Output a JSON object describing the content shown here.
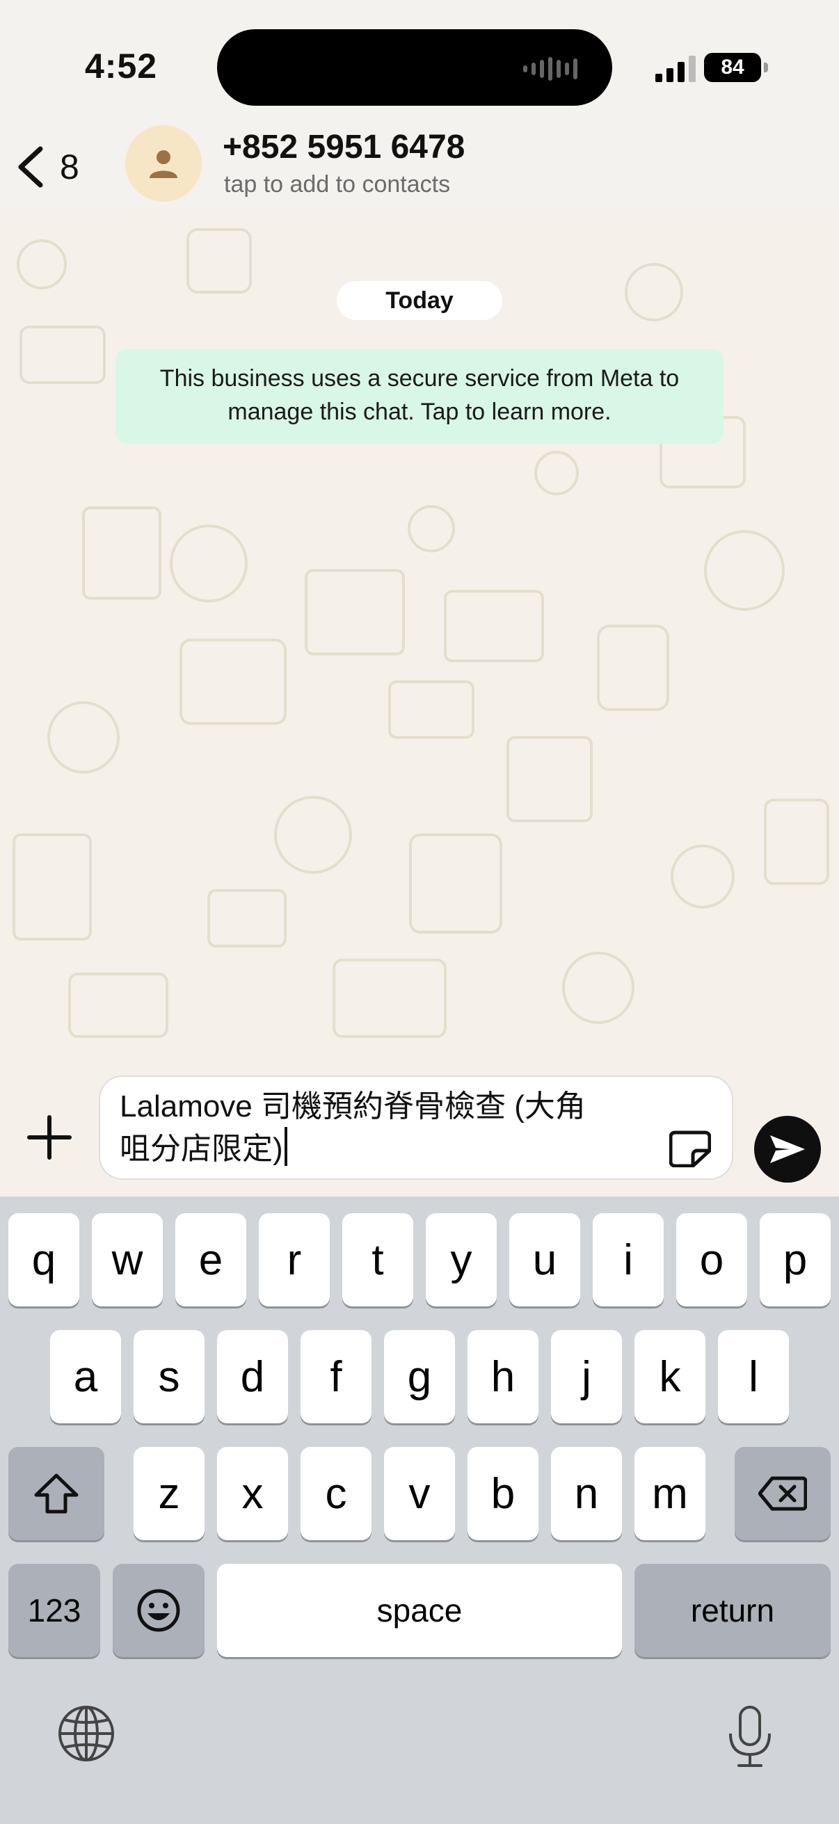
{
  "status_bar": {
    "time": "4:52",
    "battery": "84"
  },
  "header": {
    "back_count": "8",
    "title": "+852 5951 6478",
    "subtitle": "tap to add to contacts"
  },
  "chat": {
    "date_label": "Today",
    "info_message": "This business uses a secure service from Meta to manage this chat. Tap to learn more."
  },
  "composer": {
    "text_line1": "Lalamove 司機預約脊骨檢查 (大角",
    "text_line2": "咀分店限定)"
  },
  "keyboard": {
    "row1": [
      "q",
      "w",
      "e",
      "r",
      "t",
      "y",
      "u",
      "i",
      "o",
      "p"
    ],
    "row2": [
      "a",
      "s",
      "d",
      "f",
      "g",
      "h",
      "j",
      "k",
      "l"
    ],
    "row3": [
      "z",
      "x",
      "c",
      "v",
      "b",
      "n",
      "m"
    ],
    "numbers_label": "123",
    "space_label": "space",
    "return_label": "return"
  },
  "icons": {
    "back": "chevron-left-icon",
    "avatar": "person-icon",
    "plus": "plus-icon",
    "sticker": "sticker-icon",
    "send": "send-icon",
    "shift": "shift-icon",
    "delete": "delete-icon",
    "emoji": "emoji-icon",
    "globe": "globe-icon",
    "mic": "microphone-icon"
  },
  "colors": {
    "info_bubble": "#d8f7e7",
    "send_button": "#0f0f0f",
    "keyboard_bg": "#d1d4d9"
  }
}
